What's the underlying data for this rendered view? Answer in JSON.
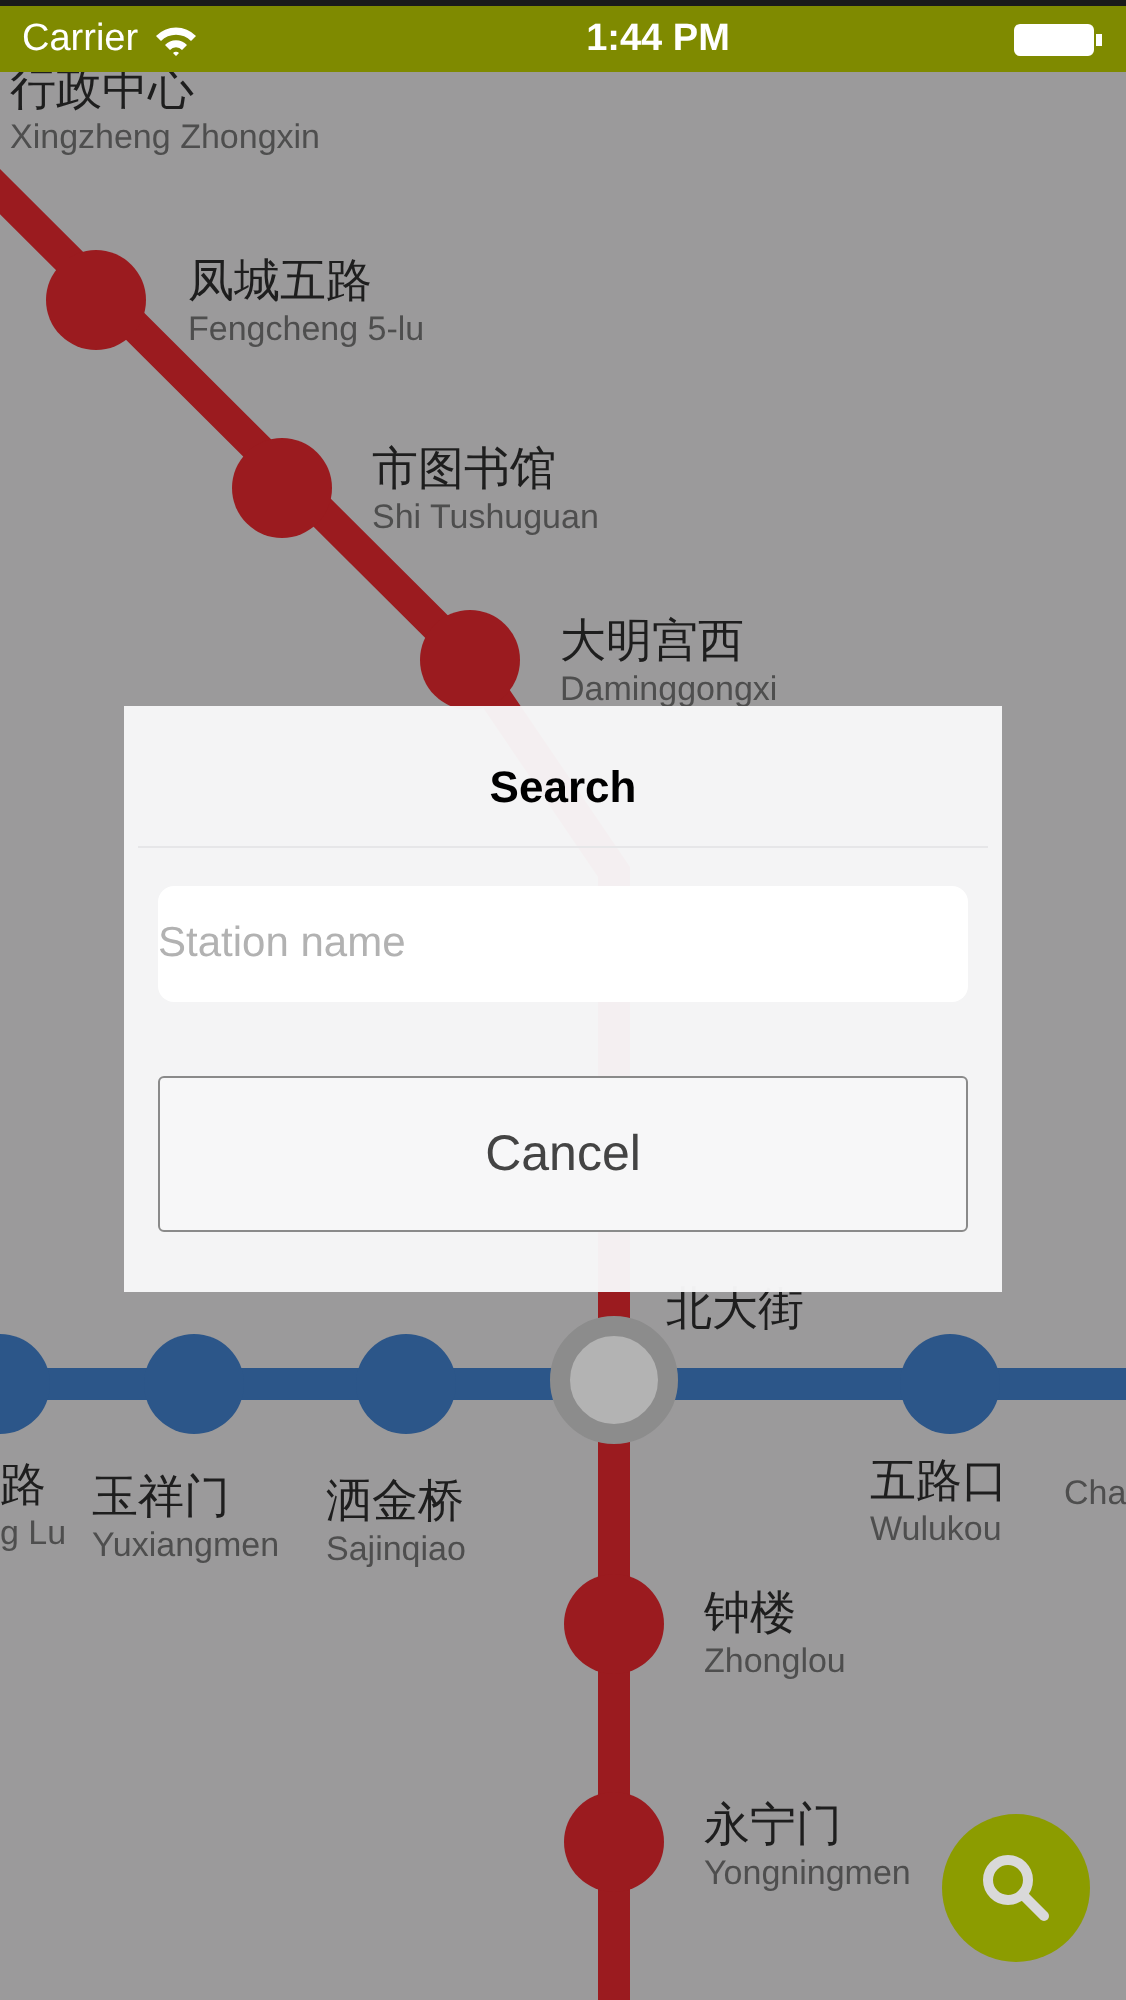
{
  "status_bar": {
    "carrier": "Carrier",
    "time": "1:44 PM"
  },
  "map": {
    "lines": [
      {
        "color": "#9b1b1f",
        "stations": [
          {
            "name": "行政中心",
            "latin": "Xingzheng Zhongxin",
            "kind": "offscreen"
          },
          {
            "name": "凤城五路",
            "latin": "Fengcheng 5-lu",
            "kind": "stop"
          },
          {
            "name": "市图书馆",
            "latin": "Shi Tushuguan",
            "kind": "stop"
          },
          {
            "name": "大明宫西",
            "latin": "Daminggongxi",
            "kind": "stop"
          },
          {
            "name": "北大街",
            "kind": "interchange"
          },
          {
            "name": "钟楼",
            "latin": "Zhonglou",
            "kind": "stop"
          },
          {
            "name": "永宁门",
            "latin": "Yongningmen",
            "kind": "stop"
          }
        ]
      },
      {
        "color": "#2c5689",
        "stations": [
          {
            "name": "路",
            "latin": "g Lu",
            "kind": "stop"
          },
          {
            "name": "玉祥门",
            "latin": "Yuxiangmen",
            "kind": "stop"
          },
          {
            "name": "洒金桥",
            "latin": "Sajinqiao",
            "kind": "stop"
          },
          {
            "name": "五路口",
            "latin": "Wulukou",
            "kind": "stop"
          },
          {
            "latin": "Cha",
            "kind": "offscreen"
          }
        ]
      }
    ]
  },
  "dialog": {
    "title": "Search",
    "search": {
      "placeholder": "Station name"
    },
    "buttons": [
      "Cancel"
    ]
  }
}
